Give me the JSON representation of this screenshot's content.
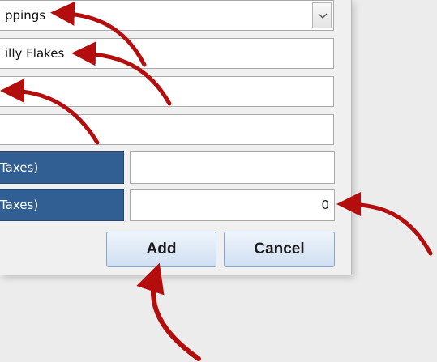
{
  "form": {
    "category_value": "ppings",
    "name_value": "illy Flakes",
    "field3_value": "",
    "field4_value": "",
    "price_label_1": "Taxes)",
    "price_value_1": "",
    "price_label_2": "Taxes)",
    "price_value_2": "0"
  },
  "buttons": {
    "add_label": "Add",
    "cancel_label": "Cancel"
  },
  "colors": {
    "label_background": "#325f93",
    "annotation_arrow": "#b30d0d",
    "button_gradient_top": "#eef4fb",
    "button_gradient_bottom": "#cfdff2"
  },
  "icons": {
    "dropdown": "chevron-down-icon",
    "annotation": "red-arrow"
  }
}
